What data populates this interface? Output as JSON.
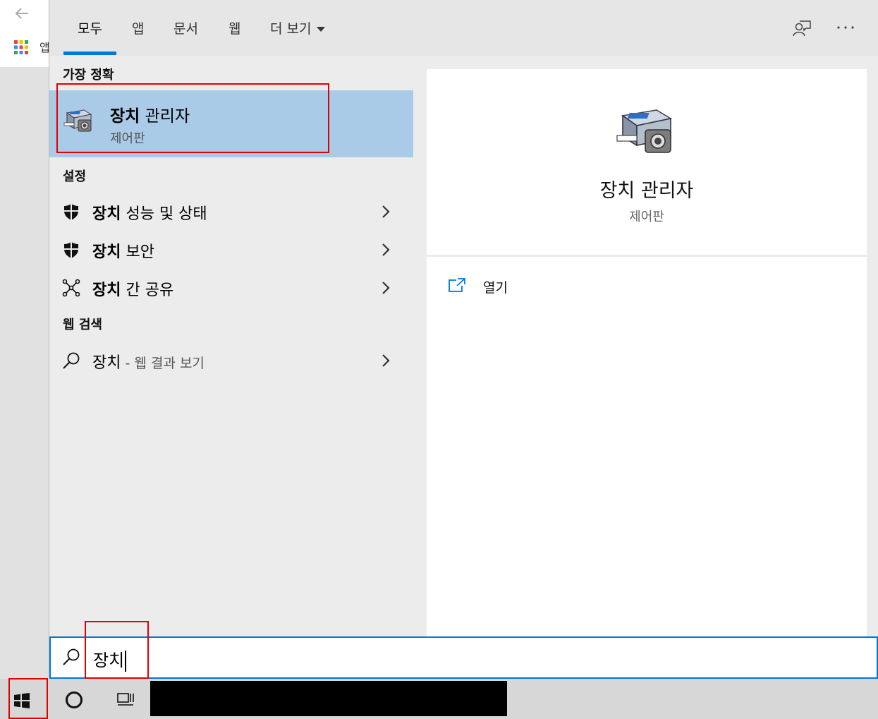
{
  "browser": {
    "apps_label": "앱"
  },
  "tabs": [
    {
      "label": "모두",
      "active": true
    },
    {
      "label": "앱"
    },
    {
      "label": "문서"
    },
    {
      "label": "웹"
    },
    {
      "label": "더 보기"
    }
  ],
  "results": {
    "best_match_header": "가장 정확",
    "best_match": {
      "title_bold": "장치",
      "title_rest": " 관리자",
      "subtitle": "제어판"
    },
    "settings_header": "설정",
    "settings_items": [
      {
        "bold": "장치",
        "rest": " 성능 및 상태",
        "icon": "shield-icon"
      },
      {
        "bold": "장치",
        "rest": " 보안",
        "icon": "shield-icon"
      },
      {
        "bold": "장치",
        "rest": " 간 공유",
        "icon": "share-nodes-icon"
      }
    ],
    "web_header": "웹 검색",
    "web_item": {
      "query": "장치",
      "suffix": " - 웹 결과 보기"
    }
  },
  "preview": {
    "title": "장치 관리자",
    "subtitle": "제어판",
    "open_label": "열기"
  },
  "search": {
    "value": "장치"
  },
  "colors": {
    "accent": "#0078d7",
    "selection": "#a9cbe8",
    "highlight": "#e00000"
  }
}
